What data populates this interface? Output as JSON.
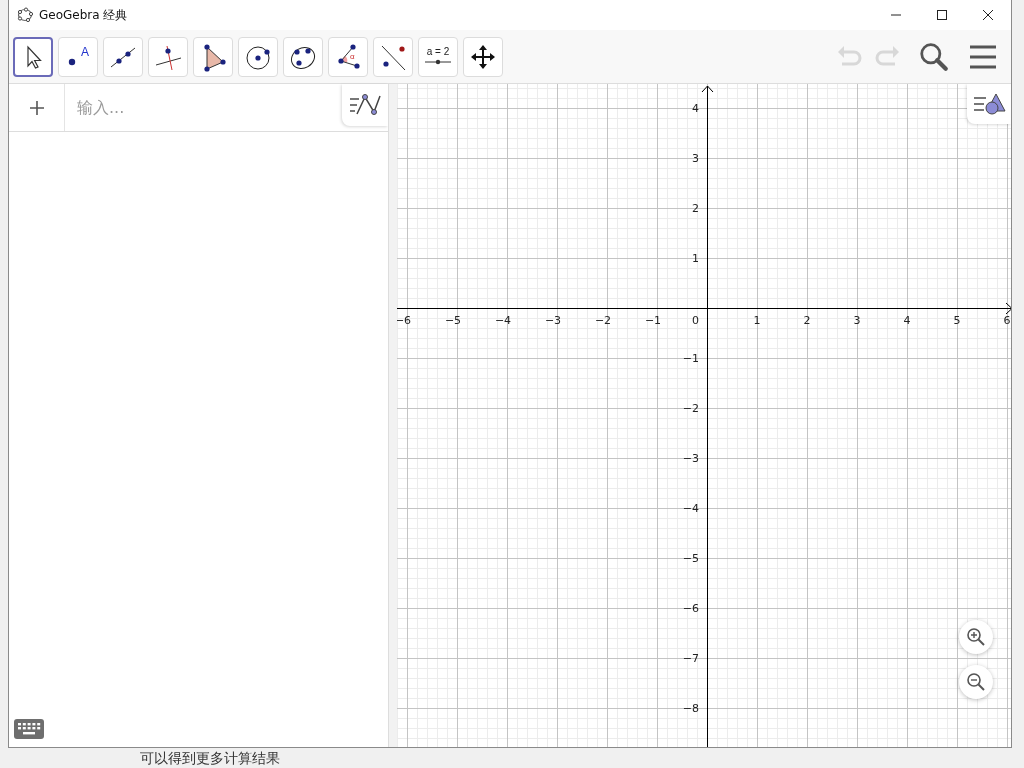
{
  "window": {
    "title": "GeoGebra 经典"
  },
  "toolbar": {
    "tools": [
      {
        "kind": "move",
        "selected": true
      },
      {
        "kind": "point",
        "label": "A",
        "selected": false
      },
      {
        "kind": "line",
        "selected": false
      },
      {
        "kind": "perpendicular",
        "selected": false
      },
      {
        "kind": "polygon",
        "selected": false
      },
      {
        "kind": "circle",
        "selected": false
      },
      {
        "kind": "conic",
        "selected": false
      },
      {
        "kind": "angle",
        "label": "α",
        "selected": false
      },
      {
        "kind": "reflect",
        "selected": false
      },
      {
        "kind": "slider",
        "label": "a = 2",
        "selected": false
      },
      {
        "kind": "pan",
        "selected": false
      }
    ],
    "undo": {
      "disabled": true
    },
    "redo": {
      "disabled": true
    }
  },
  "algebra": {
    "input": {
      "placeholder": "输入..."
    }
  },
  "graphics": {
    "origin_label": "0",
    "x_negative_labels": [
      "−6",
      "−5",
      "−4",
      "−3",
      "−2",
      "−1"
    ],
    "x_positive_labels": [
      "1",
      "2",
      "3",
      "4",
      "5",
      "6"
    ],
    "y_positive_labels": [
      "4",
      "3",
      "2",
      "1"
    ],
    "y_negative_labels": [
      "−1",
      "−2",
      "−3",
      "−4",
      "−5",
      "−6",
      "−7",
      "−8"
    ]
  },
  "background_text": "可以得到更多计算结果"
}
